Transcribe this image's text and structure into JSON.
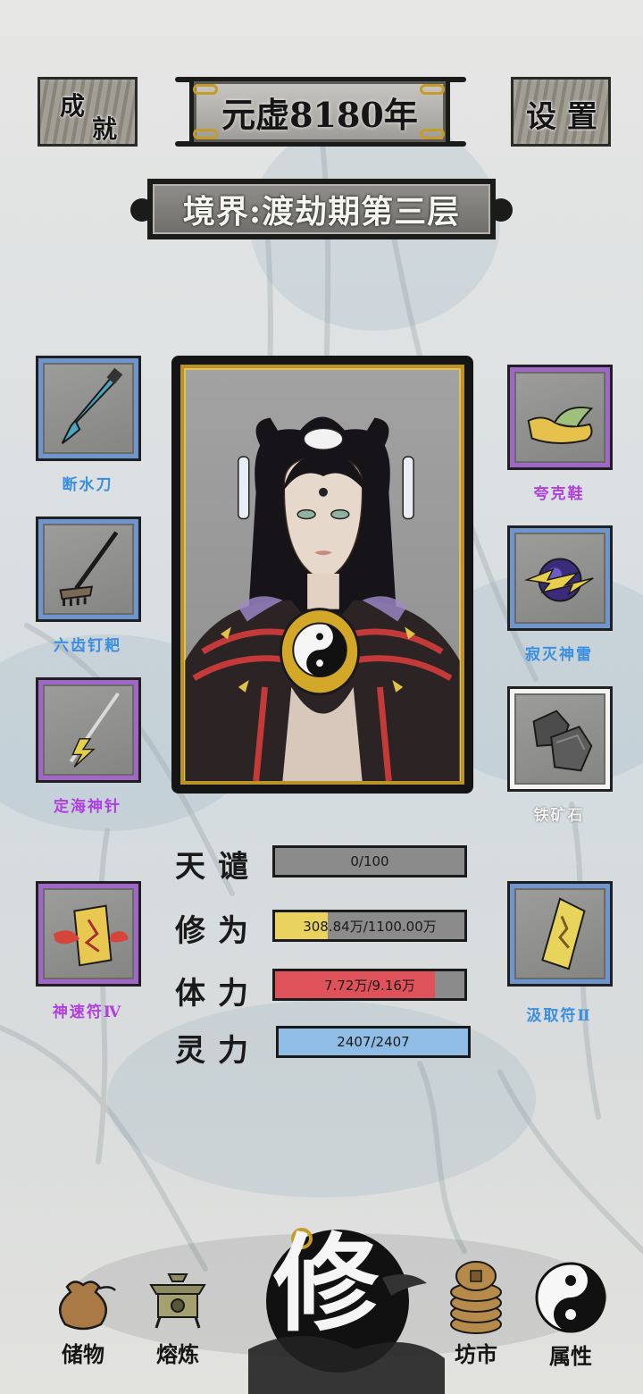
{
  "header": {
    "achievements_label_a": "成",
    "achievements_label_b": "就",
    "title": "元虚8180年",
    "settings_label": "设 置",
    "realm": "境界:渡劫期第三层"
  },
  "equipment": {
    "left": [
      {
        "name": "断水刀",
        "rarity": "blue",
        "label_color": "#3b8fe0",
        "icon": "saber-icon"
      },
      {
        "name": "六齿钉耙",
        "rarity": "blue",
        "label_color": "#3b8fe0",
        "icon": "rake-icon"
      },
      {
        "name": "定海神针",
        "rarity": "purple",
        "label_color": "#b03ee0",
        "icon": "lightning-spear-icon"
      },
      {
        "name": "神速符Ⅳ",
        "rarity": "purple",
        "label_color": "#b03ee0",
        "icon": "talisman-icon"
      }
    ],
    "right": [
      {
        "name": "夸克鞋",
        "rarity": "purple",
        "label_color": "#b03ee0",
        "icon": "shoe-icon"
      },
      {
        "name": "寂灭神雷",
        "rarity": "blue",
        "label_color": "#3b8fe0",
        "icon": "thunder-orb-icon"
      },
      {
        "name": "铁矿石",
        "rarity": "white",
        "label_color": "#f4f4f4",
        "icon": "iron-ore-icon"
      },
      {
        "name": "汲取符Ⅱ",
        "rarity": "blue",
        "label_color": "#3b8fe0",
        "icon": "talisman-icon"
      }
    ]
  },
  "stats": [
    {
      "label": "天谴",
      "text": "0/100",
      "fraction": 0.0,
      "color": "#8b8b8b"
    },
    {
      "label": "修为",
      "text": "308.84万/1100.00万",
      "fraction": 0.28,
      "color": "#e9d35e"
    },
    {
      "label": "体力",
      "text": "7.72万/9.16万",
      "fraction": 0.843,
      "color": "#e0525a"
    },
    {
      "label": "灵力",
      "text": "2407/2407",
      "fraction": 1.0,
      "color": "#8fbde6"
    }
  ],
  "nav": {
    "storage": "储物",
    "smelt": "熔炼",
    "cultivate": "修",
    "market": "坊市",
    "attributes": "属性"
  }
}
